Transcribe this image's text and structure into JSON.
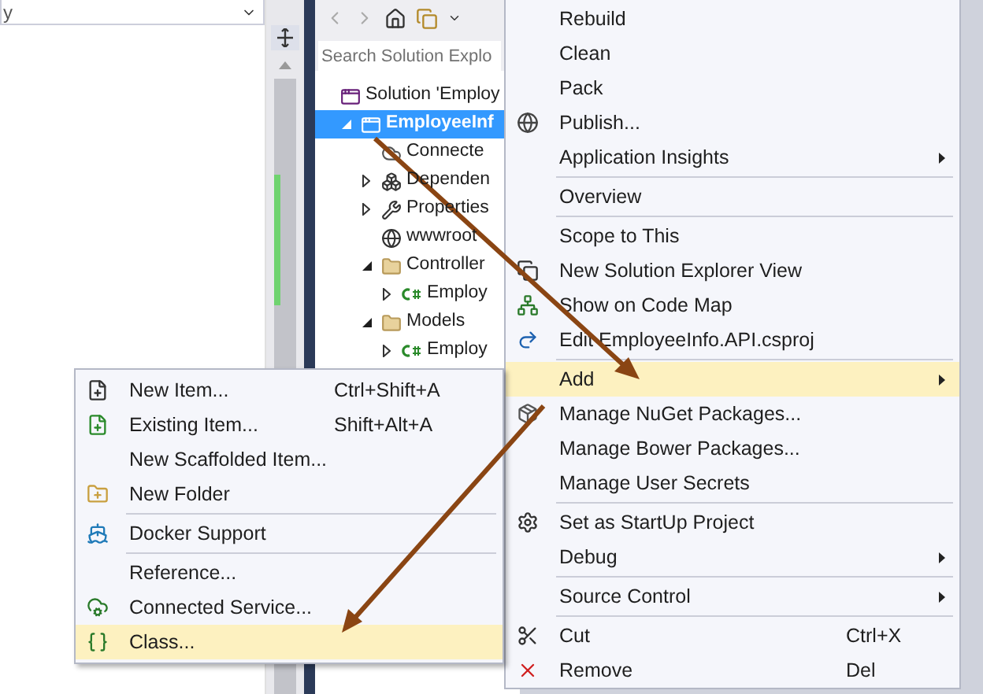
{
  "editor": {
    "dropdown": {
      "value": "y"
    }
  },
  "solution_explorer": {
    "search": {
      "placeholder": "Search Solution Explo"
    },
    "tree": [
      {
        "label": "Solution 'Employ",
        "kind": "solution",
        "selected": false,
        "children": [
          {
            "label": "EmployeeInf",
            "kind": "project",
            "selected": true,
            "expanded": true,
            "children": [
              {
                "label": "Connecte",
                "kind": "connected",
                "selected": false
              },
              {
                "label": "Dependen",
                "kind": "dependencies",
                "selected": false,
                "expanded": false
              },
              {
                "label": "Properties",
                "kind": "properties",
                "selected": false,
                "expanded": false
              },
              {
                "label": "wwwroot",
                "kind": "web",
                "selected": false
              },
              {
                "label": "Controller",
                "kind": "folder",
                "selected": false,
                "expanded": true,
                "children": [
                  {
                    "label": "Employ",
                    "kind": "csharp",
                    "selected": false,
                    "expanded": false
                  }
                ]
              },
              {
                "label": "Models",
                "kind": "folder",
                "selected": false,
                "expanded": true,
                "children": [
                  {
                    "label": "Employ",
                    "kind": "csharp",
                    "selected": false,
                    "expanded": false
                  }
                ]
              }
            ]
          }
        ]
      }
    ]
  },
  "context_menu": {
    "groups": [
      [
        {
          "label": "Rebuild",
          "selected": false,
          "submenu": false
        },
        {
          "label": "Clean",
          "selected": false,
          "submenu": false
        },
        {
          "label": "Pack",
          "selected": false,
          "submenu": false
        },
        {
          "label": "Publish...",
          "kind": "publish",
          "selected": false,
          "submenu": false
        },
        {
          "label": "Application Insights",
          "selected": false,
          "submenu": true
        }
      ],
      [
        {
          "label": "Overview",
          "selected": false,
          "submenu": false
        }
      ],
      [
        {
          "label": "Scope to This",
          "selected": false,
          "submenu": false
        },
        {
          "label": "New Solution Explorer View",
          "kind": "view",
          "selected": false,
          "submenu": false
        },
        {
          "label": "Show on Code Map",
          "kind": "map",
          "selected": false,
          "submenu": false
        },
        {
          "label": "Edit EmployeeInfo.API.csproj",
          "kind": "edit",
          "selected": false,
          "submenu": false
        }
      ],
      [
        {
          "label": "Add",
          "selected": true,
          "submenu": true
        },
        {
          "label": "Manage NuGet Packages...",
          "kind": "packages",
          "selected": false,
          "submenu": false
        },
        {
          "label": "Manage Bower Packages...",
          "selected": false,
          "submenu": false
        },
        {
          "label": "Manage User Secrets",
          "selected": false,
          "submenu": false
        }
      ],
      [
        {
          "label": "Set as StartUp Project",
          "kind": "startup",
          "selected": false,
          "submenu": false
        },
        {
          "label": "Debug",
          "selected": false,
          "submenu": true
        }
      ],
      [
        {
          "label": "Source Control",
          "selected": false,
          "submenu": true
        }
      ],
      [
        {
          "label": "Cut",
          "shortcut": "Ctrl+X",
          "kind": "cut",
          "selected": false,
          "submenu": false
        },
        {
          "label": "Remove",
          "shortcut": "Del",
          "kind": "remove",
          "selected": false,
          "submenu": false
        }
      ]
    ]
  },
  "add_submenu": {
    "groups": [
      [
        {
          "label": "New Item...",
          "shortcut": "Ctrl+Shift+A",
          "kind": "new",
          "selected": false
        },
        {
          "label": "Existing Item...",
          "shortcut": "Shift+Alt+A",
          "kind": "existing",
          "selected": false
        },
        {
          "label": "New Scaffolded Item...",
          "selected": false
        },
        {
          "label": "New Folder",
          "kind": "folder",
          "selected": false
        }
      ],
      [
        {
          "label": "Docker Support",
          "kind": "docker",
          "selected": false
        }
      ],
      [
        {
          "label": "Reference...",
          "selected": false
        },
        {
          "label": "Connected Service...",
          "kind": "service",
          "selected": false
        },
        {
          "label": "Class...",
          "kind": "class",
          "selected": true
        }
      ]
    ]
  }
}
